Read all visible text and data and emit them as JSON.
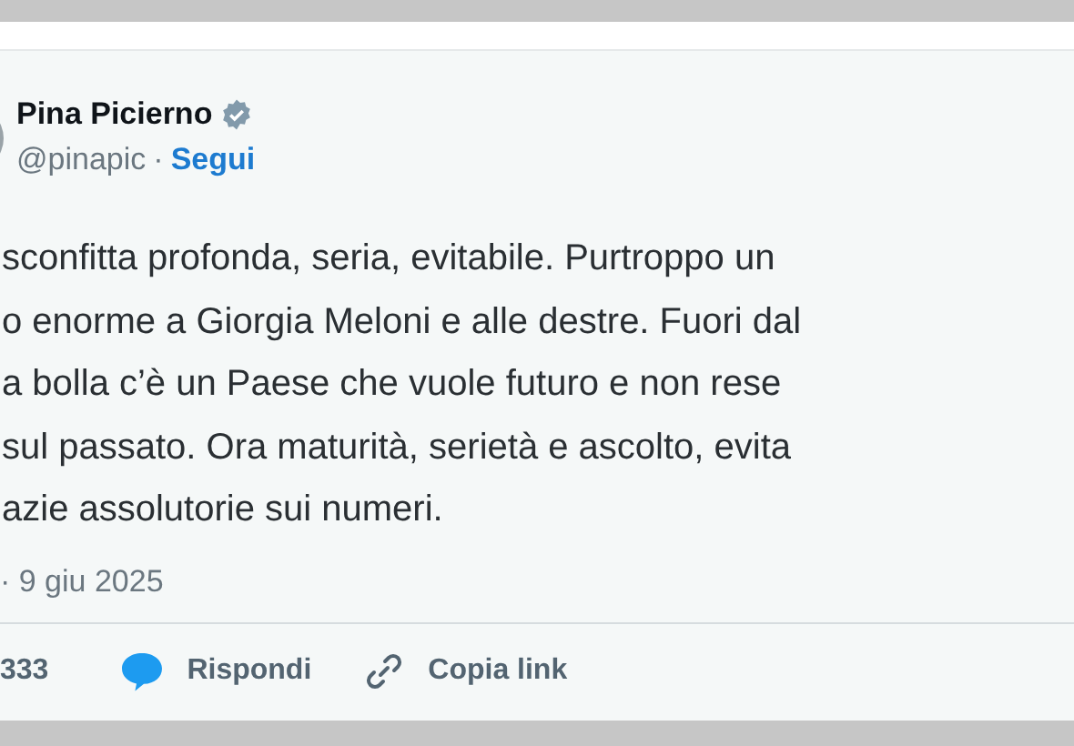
{
  "author": {
    "name": "Pina Picierno",
    "verified": true,
    "handle": "@pinapic",
    "separator": "·",
    "follow": "Segui"
  },
  "text_lines": [
    "sconfitta profonda, seria, evitabile. Purtroppo un",
    "o enorme a Giorgia Meloni e alle destre. Fuori dal",
    "a bolla c’è un Paese che vuole futuro e non rese",
    "sul passato. Ora maturità, serietà e ascolto, evita",
    "azie assolutorie sui numeri."
  ],
  "timestamp": "· 9 giu 2025",
  "actions": [
    {
      "kind": "count",
      "label": "333"
    },
    {
      "kind": "reply",
      "label": "Rispondi"
    },
    {
      "kind": "copy-link",
      "label": "Copia link"
    }
  ]
}
